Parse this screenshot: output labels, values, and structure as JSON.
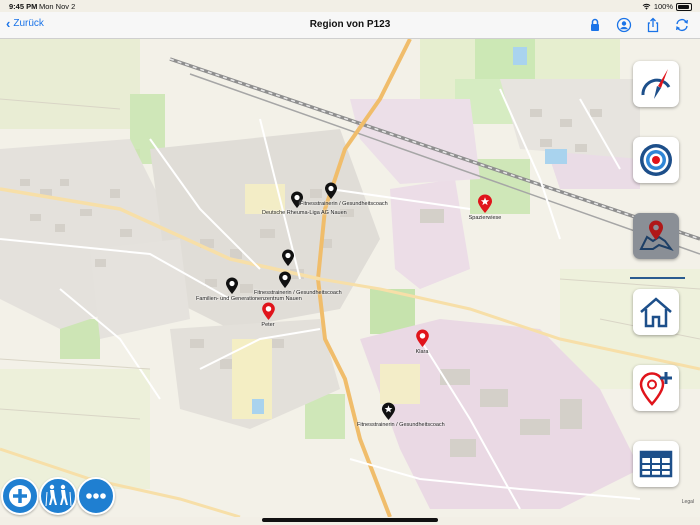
{
  "status": {
    "time": "9:45 PM",
    "date": "Mon Nov 2",
    "battery": "100%"
  },
  "nav": {
    "back_label": "Zurück",
    "title": "Region von P123"
  },
  "nav_icons": [
    "lock-icon",
    "person-circle-icon",
    "share-icon",
    "refresh-icon"
  ],
  "pois": [
    {
      "id": "rheuma",
      "label": "Deutsche Rheuma-Liga AG Nauen",
      "color": "#111111"
    },
    {
      "id": "fitness1",
      "label": "Fitnesstrainerin / Gesundheitscoach",
      "color": "#111111"
    },
    {
      "id": "spazierwiese",
      "label": "Spazierwiese",
      "color": "#e0141b"
    },
    {
      "id": "black_pin",
      "label": "",
      "color": "#111111"
    },
    {
      "id": "fitness2",
      "label": "Fitnesstrainerin / Gesundheitscoach",
      "color": "#111111"
    },
    {
      "id": "familien",
      "label": "Familien- und Generationenzentrum Nauen",
      "color": "#111111"
    },
    {
      "id": "peter",
      "label": "Peter",
      "color": "#e0141b"
    },
    {
      "id": "klara",
      "label": "Klara",
      "color": "#e0141b"
    },
    {
      "id": "fitness3",
      "label": "Fitnesstrainerin / Gesundheitscoach",
      "color": "#111111"
    }
  ],
  "side_buttons": [
    "compass-needle-icon",
    "target-icon",
    "map-pin-icon",
    "home-icon",
    "add-location-icon",
    "table-icon"
  ],
  "bottom_buttons": [
    "add-icon",
    "hikers-icon",
    "more-icon"
  ],
  "legal": "Legal",
  "colors": {
    "accent": "#1a73e8",
    "red_pin": "#e0141b",
    "dark_pin": "#111111",
    "button_blue": "#1f7fd1",
    "map_bg": "#f2efe6"
  }
}
